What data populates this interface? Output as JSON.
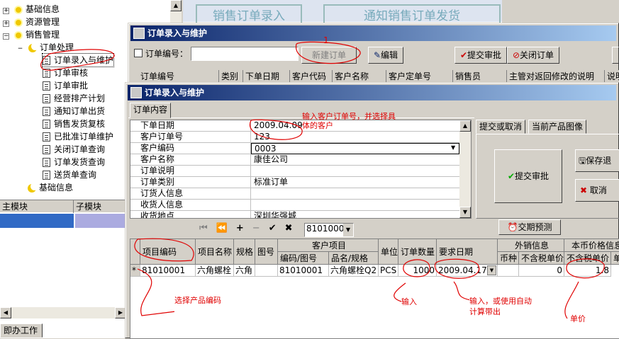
{
  "sidebar": {
    "tree": [
      {
        "label": "基础信息"
      },
      {
        "label": "资源管理"
      },
      {
        "label": "销售管理"
      },
      {
        "label": "订单处理"
      },
      {
        "label": "订单录入与维护"
      },
      {
        "label": "订单审核"
      },
      {
        "label": "订单审批"
      },
      {
        "label": "经营排产计划"
      },
      {
        "label": "通知订单出货"
      },
      {
        "label": "销售发货复核"
      },
      {
        "label": "已批准订单维护"
      },
      {
        "label": "关闭订单查询"
      },
      {
        "label": "订单发货查询"
      },
      {
        "label": "送货单查询"
      },
      {
        "label": "基础信息"
      }
    ],
    "header": {
      "col1": "主模块",
      "col2": "子模块"
    },
    "bottom_tab": "即办工作"
  },
  "bg_window": {
    "banner1": "销售订单录入",
    "banner2": "通知销售订单发货",
    "title": "订单录入与维护",
    "order_no_label": "订单编号：",
    "new_order": "新建订单",
    "edit": "编辑",
    "submit": "提交审批",
    "close_order": "关闭订单",
    "cols": [
      "订单编号",
      "类别",
      "下单日期",
      "客户代码",
      "客户名称",
      "客户定单号",
      "销售员",
      "主管对返回修改的说明",
      "说明"
    ]
  },
  "fg_window": {
    "title": "订单录入与维护",
    "tab": "订单内容",
    "props": [
      {
        "label": "下单日期",
        "value": "2009.04.09"
      },
      {
        "label": "客户订单号",
        "value": "123"
      },
      {
        "label": "客户编码",
        "value": "0003"
      },
      {
        "label": "客户名称",
        "value": "康佳公司"
      },
      {
        "label": "订单说明",
        "value": ""
      },
      {
        "label": "订单类别",
        "value": "标准订单"
      },
      {
        "label": "订货人信息",
        "value": ""
      },
      {
        "label": "收货人信息",
        "value": ""
      },
      {
        "label": "收货地点",
        "value": "深圳华强城"
      }
    ],
    "right_tabs": [
      "提交或取消",
      "当前产品图像"
    ],
    "submit": "提交审批",
    "save": "保存退",
    "cancel": "取消",
    "forecast": "交期预测",
    "nav_combo": "81010001",
    "grid": {
      "group_headers": [
        "客户项目",
        "外销信息",
        "本币价格信息"
      ],
      "cols": [
        "项目编码",
        "项目名称",
        "规格",
        "图号",
        "编码/图号",
        "品名/规格",
        "单位",
        "订单数量",
        "要求日期",
        "币种",
        "不含税单价",
        "不含税单价",
        "单价"
      ],
      "row": {
        "marker": "*",
        "code": "81010001",
        "name": "六角螺栓",
        "spec": "六角",
        "drawing": "",
        "cust_code": "81010001",
        "cust_name": "六角螺栓Q2",
        "unit": "PCS",
        "qty": "1000",
        "date": "2009.04.17",
        "currency": "",
        "ex_price": "0",
        "price": "1.8"
      }
    }
  },
  "annotations": {
    "one": "1",
    "a1": "输入客户订单号，并选择具体的客户",
    "a2": "选择产品编码",
    "a3": "输入",
    "a4": "输入，或使用自动计算带出",
    "a5": "单价"
  },
  "colors": {
    "accent": "#0a246a",
    "annot": "#e00000",
    "select": "#316ac5"
  }
}
